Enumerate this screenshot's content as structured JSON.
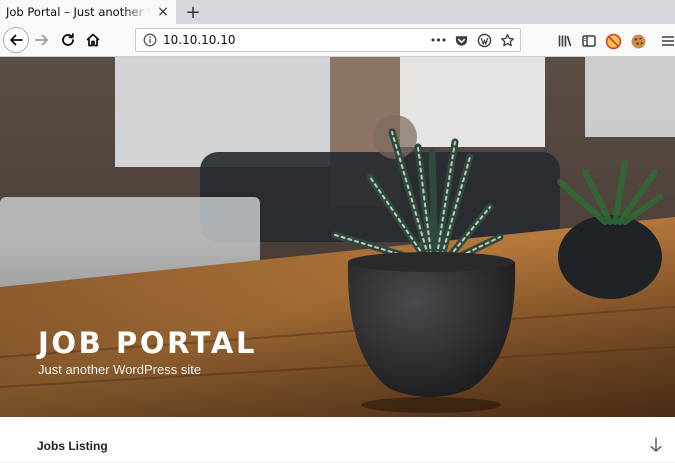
{
  "browser": {
    "tab_title": "Job Portal – Just another WordPress site",
    "close_tab_glyph": "×",
    "new_tab_glyph": "+",
    "url": "10.10.10.10",
    "page_actions_glyph": "•••",
    "icons": [
      "back-arrow-icon",
      "forward-arrow-icon",
      "reload-icon",
      "home-icon",
      "info-icon",
      "pocket-icon",
      "wordpress-icon",
      "bookmark-star-icon",
      "library-icon",
      "sidebar-icon",
      "blocker-extension-icon",
      "cookie-extension-icon",
      "hamburger-menu-icon"
    ]
  },
  "site": {
    "title": "JOB PORTAL",
    "description": "Just another WordPress site"
  },
  "menu": {
    "items": [
      {
        "label": "Jobs Listing"
      }
    ],
    "scroll_icon": "arrow-down-icon"
  },
  "colors": {
    "chrome_bg": "#f9f9fa",
    "tabstrip_bg": "#d7d7db",
    "title_text": "#ffffff",
    "menu_text": "#222222"
  }
}
